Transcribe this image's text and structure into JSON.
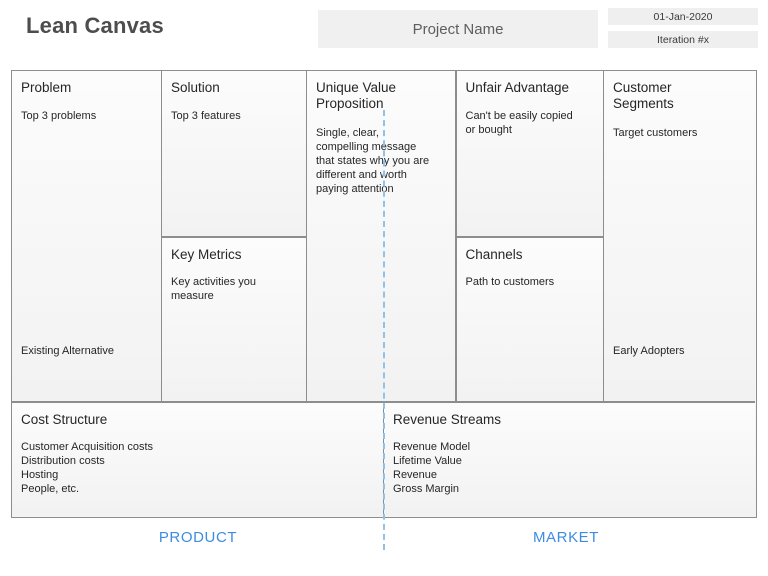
{
  "header": {
    "title": "Lean Canvas",
    "project_name": "Project Name",
    "date": "01-Jan-2020",
    "iteration": "Iteration #x"
  },
  "canvas": {
    "cells": {
      "problem": {
        "title": "Problem",
        "body": "Top 3 problems",
        "footer": "Existing Alternative"
      },
      "solution": {
        "title": "Solution",
        "body": "Top 3 features"
      },
      "key_metrics": {
        "title": "Key Metrics",
        "body": "Key activities you\nmeasure"
      },
      "unique_value_proposition": {
        "title": "Unique Value Proposition",
        "body": "Single, clear,\ncompelling message\nthat states why you are\ndifferent and worth\npaying attention"
      },
      "unfair_advantage": {
        "title": "Unfair Advantage",
        "body": "Can't be easily copied\nor bought"
      },
      "channels": {
        "title": "Channels",
        "body": "Path to customers"
      },
      "customer_segments": {
        "title": "Customer Segments",
        "body": "Target customers",
        "footer": "Early Adopters"
      },
      "cost_structure": {
        "title": "Cost Structure",
        "body": "Customer Acquisition costs\nDistribution costs\nHosting\nPeople, etc."
      },
      "revenue_streams": {
        "title": "Revenue Streams",
        "body": "Revenue Model\nLifetime Value\nRevenue\nGross Margin"
      }
    }
  },
  "footer": {
    "product_label": "PRODUCT",
    "market_label": "MARKET"
  },
  "colors": {
    "accent_blue": "#3d8ce0",
    "dashed_line": "#8fc2ea",
    "border_gray": "#8d8d8d",
    "title_gray": "#4d4d4d",
    "box_fill": "#f0f0f0"
  }
}
